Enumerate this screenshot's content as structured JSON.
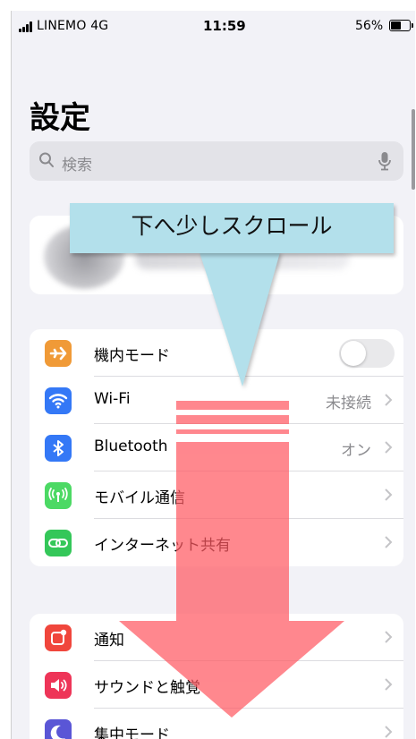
{
  "status": {
    "carrier": "LINEMO  4G",
    "time": "11:59",
    "battery": "56%"
  },
  "title": "設定",
  "search": {
    "placeholder": "検索"
  },
  "group1": [
    {
      "icon": "airplane-icon",
      "color": "#f09a37",
      "label": "機内モード",
      "value": "",
      "toggle": false
    },
    {
      "icon": "wifi-icon",
      "color": "#3478f6",
      "label": "Wi-Fi",
      "value": "未接続"
    },
    {
      "icon": "bluetooth-icon",
      "color": "#3478f6",
      "label": "Bluetooth",
      "value": "オン"
    },
    {
      "icon": "cellular-icon",
      "color": "#4cd964",
      "label": "モバイル通信",
      "value": ""
    },
    {
      "icon": "hotspot-icon",
      "color": "#34c759",
      "label": "インターネット共有",
      "value": ""
    }
  ],
  "group2": [
    {
      "icon": "notification-icon",
      "color": "#f0463c",
      "label": "通知",
      "value": ""
    },
    {
      "icon": "sound-icon",
      "color": "#ee3558",
      "label": "サウンドと触覚",
      "value": ""
    },
    {
      "icon": "moon-icon",
      "color": "#5a56d6",
      "label": "集中モード",
      "value": ""
    }
  ],
  "annotation": {
    "callout": "下へ少しスクロール",
    "arrow_color": "#ff5a63",
    "callout_color": "#b3e0eb"
  }
}
